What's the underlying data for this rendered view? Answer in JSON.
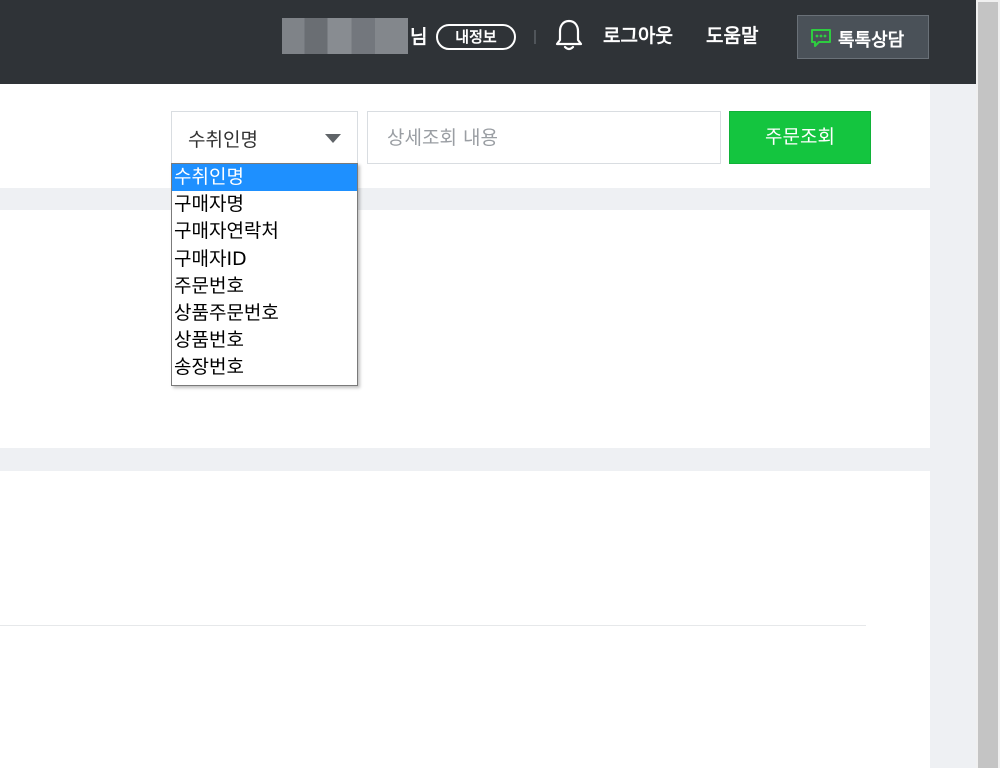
{
  "header": {
    "honorific": "님",
    "my_info_label": "내정보",
    "notification_icon": "bell-icon",
    "logout_label": "로그아웃",
    "help_label": "도움말",
    "talk_button": {
      "label": "톡톡상담",
      "icon": "chat-icon"
    }
  },
  "search": {
    "field_select": {
      "selected": "수취인명",
      "options": [
        "수취인명",
        "구매자명",
        "구매자연락처",
        "구매자ID",
        "주문번호",
        "상품주문번호",
        "상품번호",
        "송장번호"
      ],
      "highlighted_index": 0
    },
    "input": {
      "placeholder": "상세조회 내용",
      "value": ""
    },
    "submit_label": "주문조회"
  },
  "colors": {
    "header_bg": "#2f3337",
    "accent_green": "#14c53f",
    "page_bg": "#eef0f3",
    "highlight_blue": "#1e90ff"
  }
}
